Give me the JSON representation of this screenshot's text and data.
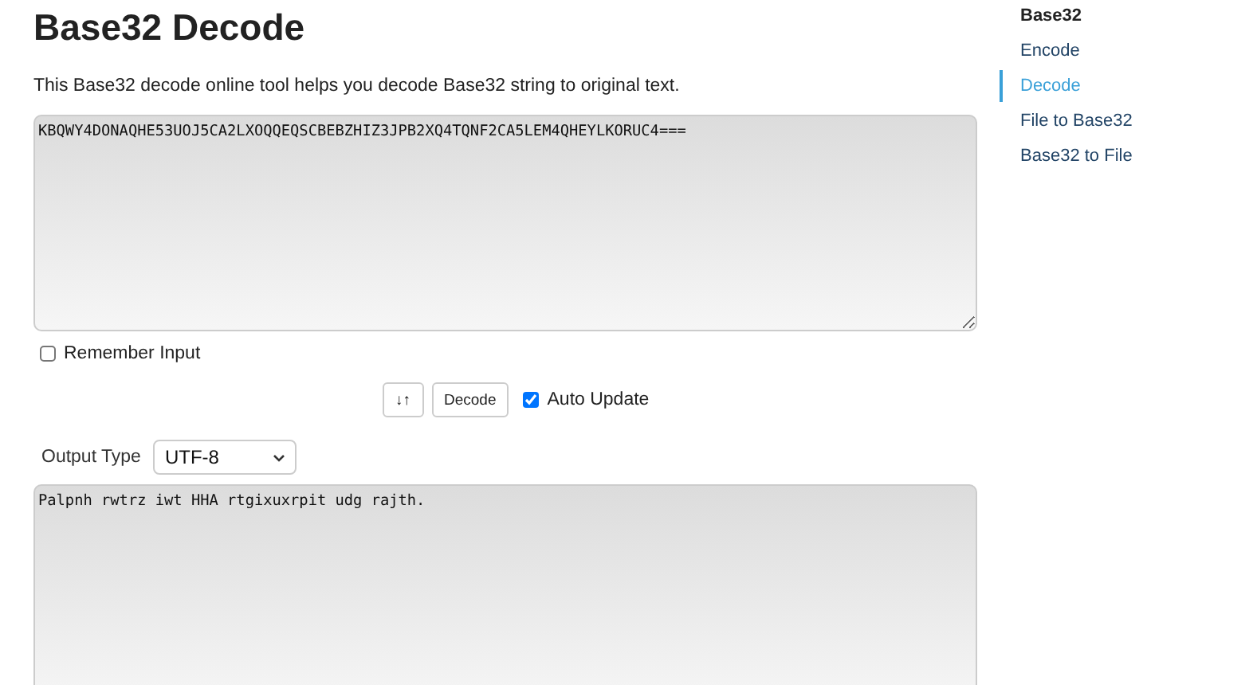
{
  "title": "Base32 Decode",
  "description": "This Base32 decode online tool helps you decode Base32 string to original text.",
  "input": {
    "value": "KBQWY4DONAQHE53UOJ5CA2LXOQQEQSCBEBZHIZ3JPB2XQ4TQNF2CA5LEM4QHEYLKORUC4==="
  },
  "remember_input": {
    "label": "Remember Input",
    "checked": false
  },
  "swap_button": {
    "label": "↓↑"
  },
  "decode_button": {
    "label": "Decode"
  },
  "auto_update": {
    "label": "Auto Update",
    "checked": true
  },
  "output_type": {
    "label": "Output Type",
    "value": "UTF-8"
  },
  "output": {
    "value": "Palpnh rwtrz iwt HHA rtgixuxrpit udg rajth."
  },
  "sidebar": {
    "heading": "Base32",
    "items": [
      {
        "label": "Encode",
        "selected": false
      },
      {
        "label": "Decode",
        "selected": true
      },
      {
        "label": "File to Base32",
        "selected": false
      },
      {
        "label": "Base32 to File",
        "selected": false
      }
    ]
  }
}
